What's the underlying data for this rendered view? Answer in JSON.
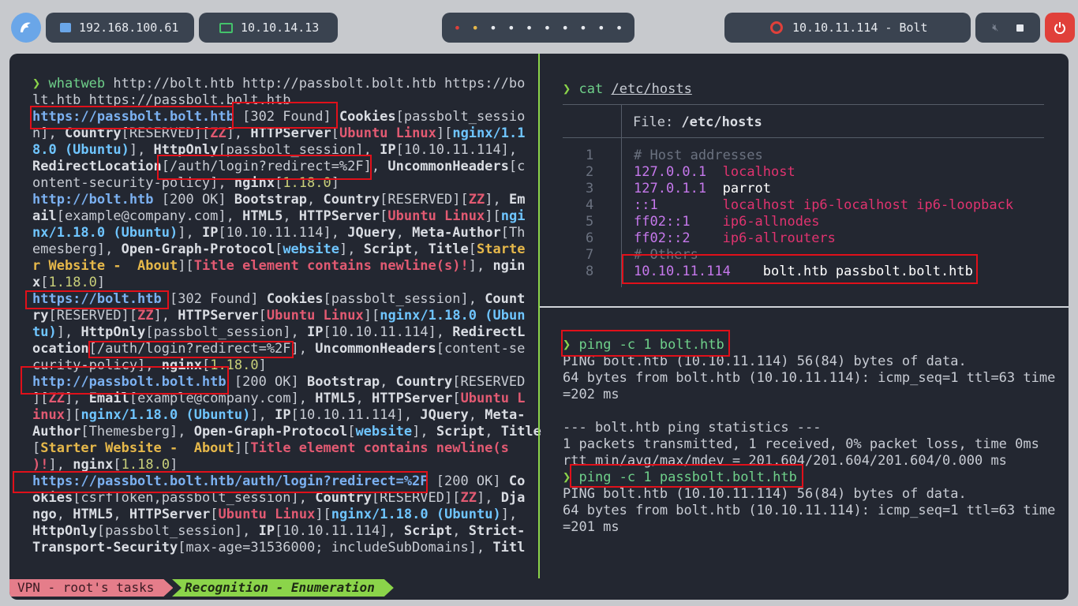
{
  "topbar": {
    "ip_local": "192.168.100.61",
    "ip_vpn": "10.10.14.13",
    "target": "10.10.11.114 - Bolt",
    "workspaces": [
      "•",
      "•",
      "•",
      "•",
      "•",
      "•",
      "•",
      "•",
      "•",
      "•"
    ]
  },
  "left_pane": {
    "prompt": "❯",
    "command": "whatweb",
    "args": " http://bolt.htb http://passbolt.bolt.htb https://bo",
    "args2": "lt.htb https://passbolt.bolt.htb"
  },
  "right_top": {
    "prompt": "❯",
    "command": "cat",
    "arg": "/etc/hosts",
    "file_label": "File: ",
    "file_name": "/etc/hosts",
    "line_numbers": [
      "1",
      "2",
      "3",
      "4",
      "5",
      "6",
      "7",
      "8"
    ],
    "lines": [
      {
        "a": "# Host addresses",
        "b": ""
      },
      {
        "a": "127.0.0.1",
        "b": "localhost"
      },
      {
        "a": "127.0.1.1",
        "b": "parrot"
      },
      {
        "a": "::1",
        "b": "localhost ip6-localhost ip6-loopback"
      },
      {
        "a": "ff02::1",
        "b": "ip6-allnodes"
      },
      {
        "a": "ff02::2",
        "b": "ip6-allrouters"
      },
      {
        "a": "# Others",
        "b": ""
      },
      {
        "a": "10.10.11.114",
        "b": "bolt.htb passbolt.bolt.htb"
      }
    ]
  },
  "right_bottom": {
    "prompt": "❯",
    "cmd1": "ping -c 1 bolt.htb",
    "out1": [
      "PING bolt.htb (10.10.11.114) 56(84) bytes of data.",
      "64 bytes from bolt.htb (10.10.11.114): icmp_seq=1 ttl=63 time",
      "=202 ms",
      "",
      "--- bolt.htb ping statistics ---",
      "1 packets transmitted, 1 received, 0% packet loss, time 0ms",
      "rtt min/avg/max/mdev = 201.604/201.604/201.604/0.000 ms"
    ],
    "cmd2": "ping -c 1 passbolt.bolt.htb",
    "out2": [
      "PING bolt.htb (10.10.11.114) 56(84) bytes of data.",
      "64 bytes from bolt.htb (10.10.11.114): icmp_seq=1 ttl=63 time",
      "=201 ms"
    ]
  },
  "status": {
    "session": "VPN - root's tasks",
    "window": "Recognition - Enumeration"
  }
}
